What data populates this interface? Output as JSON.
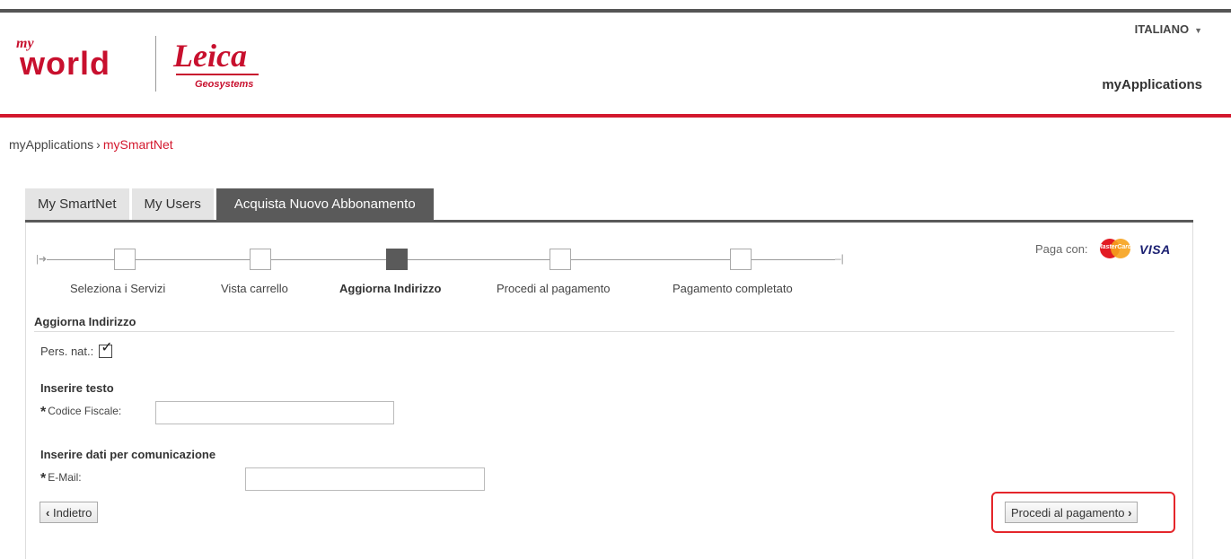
{
  "header": {
    "logo_my": "my",
    "logo_world": "world",
    "logo_brand": "Leica",
    "logo_sub": "Geosystems",
    "language": "ITALIANO",
    "app_title": "myApplications"
  },
  "breadcrumb": {
    "root": "myApplications",
    "separator": "›",
    "current": "mySmartNet"
  },
  "tabs": [
    {
      "label": "My SmartNet"
    },
    {
      "label": "My Users"
    },
    {
      "label": "Acquista Nuovo Abbonamento"
    }
  ],
  "wizard": {
    "steps": [
      {
        "label": "Seleziona i Servizi"
      },
      {
        "label": "Vista carrello"
      },
      {
        "label": "Aggiorna Indirizzo"
      },
      {
        "label": "Procedi al pagamento"
      },
      {
        "label": "Pagamento completato"
      }
    ],
    "current_step": 3
  },
  "payment": {
    "label": "Paga con:",
    "mastercard": "MasterCard",
    "visa": "VISA"
  },
  "form": {
    "section_title": "Aggiorna Indirizzo",
    "pers_label": "Pers. nat.:",
    "pers_checked": true,
    "text_section": "Inserire testo",
    "codice_label": "Codice Fiscale:",
    "codice_value": "",
    "comm_section": "Inserire dati per comunicazione",
    "email_label": "E-Mail:",
    "email_value": "",
    "required_mark": "*"
  },
  "buttons": {
    "back": "Indietro",
    "back_icon": "‹",
    "next": "Procedi al pagamento",
    "next_icon": "›"
  },
  "colors": {
    "brand_red": "#d3192e",
    "tab_active": "#5a5a5a",
    "highlight": "#e4262b"
  }
}
